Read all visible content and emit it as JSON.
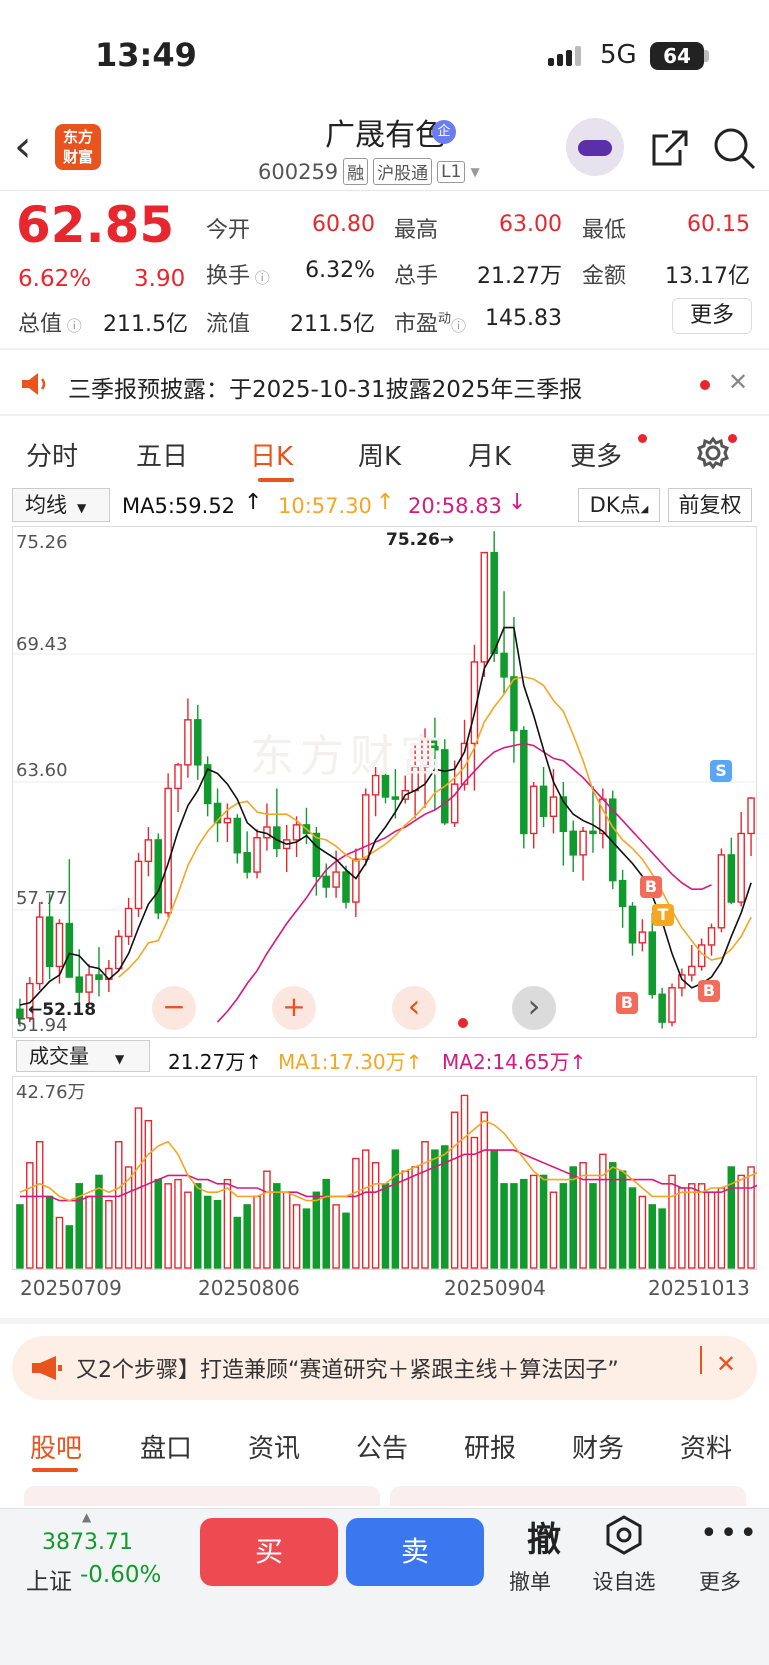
{
  "status_bar": {
    "time": "13:49",
    "network": "5G",
    "battery": "64"
  },
  "header": {
    "logo_line1": "东方",
    "logo_line2": "财富",
    "name": "广晟有色",
    "name_badge": "企",
    "code": "600259",
    "tags": [
      "融",
      "沪股通",
      "L1"
    ]
  },
  "quote": {
    "price": "62.85",
    "change_pct": "6.62%",
    "change_amt": "3.90",
    "rows": [
      [
        {
          "label": "今开",
          "value": "60.80",
          "color": "red"
        },
        {
          "label": "最高",
          "value": "63.00",
          "color": "red"
        },
        {
          "label": "最低",
          "value": "60.15",
          "color": "red"
        }
      ],
      [
        {
          "label": "换手",
          "value": "6.32%",
          "color": "dark"
        },
        {
          "label": "总手",
          "value": "21.27万",
          "color": "dark"
        },
        {
          "label": "金额",
          "value": "13.17亿",
          "color": "dark"
        }
      ],
      [
        {
          "label": "总值",
          "value": "211.5亿",
          "color": "dark"
        },
        {
          "label": "流值",
          "value": "211.5亿",
          "color": "dark"
        },
        {
          "label": "市盈",
          "sup": "动",
          "value": "145.83",
          "color": "dark"
        }
      ]
    ],
    "more_label": "更多"
  },
  "notice": {
    "text": "三季报预披露：于2025-10-31披露2025年三季报"
  },
  "period_tabs": [
    "分时",
    "五日",
    "日K",
    "周K",
    "月K",
    "更多"
  ],
  "active_period": "日K",
  "chart_toolbar": {
    "indicator": "均线",
    "ma5": "MA5:59.52",
    "ma10": "10:57.30",
    "ma20": "20:58.83",
    "dk": "DK点",
    "adjust": "前复权"
  },
  "volume_toolbar": {
    "indicator": "成交量",
    "value": "21.27万",
    "ma1": "MA1:17.30万",
    "ma2": "MA2:14.65万"
  },
  "colors": {
    "up": "#e8262e",
    "down": "#119a2d",
    "ma5": "#111111",
    "ma10": "#f5a623",
    "ma20": "#d6197e",
    "accent": "#e8531e"
  },
  "chart_data": {
    "type": "candlestick",
    "price_axis": {
      "ticks": [
        "75.26",
        "69.43",
        "63.60",
        "57.77",
        "51.94"
      ],
      "ylim": [
        51.94,
        75.26
      ]
    },
    "volume_axis": {
      "max_label": "42.76万",
      "ylim": [
        0,
        42.76
      ]
    },
    "x_labels": [
      "20250709",
      "20250806",
      "20250904",
      "20251013"
    ],
    "annotations": {
      "high": "75.26→",
      "low": "←52.18",
      "signals": [
        "B",
        "T",
        "B",
        "B",
        "S"
      ]
    },
    "candles": [
      [
        53.0,
        53.5,
        52.2,
        52.6
      ],
      [
        52.6,
        54.5,
        52.4,
        54.2
      ],
      [
        54.2,
        58.0,
        53.9,
        57.3
      ],
      [
        57.3,
        58.4,
        54.4,
        55.0
      ],
      [
        55.0,
        57.2,
        54.2,
        57.0
      ],
      [
        57.0,
        60.0,
        54.6,
        54.5
      ],
      [
        54.5,
        55.8,
        53.1,
        53.8
      ],
      [
        53.8,
        55.1,
        53.3,
        54.6
      ],
      [
        54.6,
        55.9,
        53.6,
        54.4
      ],
      [
        54.4,
        55.3,
        53.8,
        54.9
      ],
      [
        54.9,
        56.7,
        54.8,
        56.4
      ],
      [
        56.4,
        58.2,
        56.0,
        57.7
      ],
      [
        57.7,
        60.3,
        57.3,
        59.9
      ],
      [
        59.9,
        61.5,
        59.2,
        60.9
      ],
      [
        60.9,
        61.2,
        57.2,
        57.5
      ],
      [
        57.5,
        64.0,
        57.3,
        63.3
      ],
      [
        63.3,
        64.5,
        62.2,
        64.4
      ],
      [
        64.4,
        67.5,
        63.8,
        66.5
      ],
      [
        66.5,
        67.2,
        63.7,
        64.4
      ],
      [
        64.4,
        64.8,
        62.0,
        62.6
      ],
      [
        62.6,
        63.3,
        60.8,
        61.7
      ],
      [
        61.7,
        62.6,
        60.8,
        61.9
      ],
      [
        61.9,
        62.1,
        59.8,
        60.3
      ],
      [
        60.3,
        61.3,
        59.1,
        59.4
      ],
      [
        59.4,
        61.4,
        59.1,
        61.0
      ],
      [
        61.0,
        62.6,
        60.4,
        61.5
      ],
      [
        61.5,
        63.3,
        60.1,
        60.5
      ],
      [
        60.5,
        61.6,
        59.4,
        60.9
      ],
      [
        60.9,
        62.0,
        60.1,
        61.6
      ],
      [
        61.6,
        62.4,
        60.7,
        61.2
      ],
      [
        61.2,
        61.5,
        58.3,
        59.2
      ],
      [
        59.2,
        59.8,
        58.2,
        58.7
      ],
      [
        58.7,
        60.4,
        58.2,
        59.4
      ],
      [
        59.4,
        59.7,
        57.7,
        58.0
      ],
      [
        58.0,
        60.5,
        57.3,
        60.0
      ],
      [
        60.0,
        63.3,
        59.7,
        63.0
      ],
      [
        63.0,
        64.3,
        62.0,
        63.9
      ],
      [
        63.9,
        64.7,
        62.6,
        62.9
      ],
      [
        62.9,
        64.2,
        61.9,
        62.8
      ],
      [
        62.8,
        63.9,
        62.6,
        63.2
      ],
      [
        63.2,
        65.3,
        61.9,
        64.3
      ],
      [
        64.3,
        66.1,
        62.4,
        65.6
      ],
      [
        65.6,
        66.6,
        62.3,
        65.1
      ],
      [
        65.1,
        65.6,
        61.6,
        61.7
      ],
      [
        61.7,
        64.6,
        61.5,
        63.5
      ],
      [
        63.5,
        66.5,
        63.2,
        65.4
      ],
      [
        65.4,
        70.0,
        63.2,
        69.2
      ],
      [
        69.2,
        74.3,
        68.5,
        74.3
      ],
      [
        74.3,
        75.3,
        69.2,
        69.6
      ],
      [
        69.6,
        72.5,
        67.7,
        68.5
      ],
      [
        68.5,
        71.3,
        64.5,
        66.0
      ],
      [
        66.0,
        66.2,
        60.5,
        61.2
      ],
      [
        61.2,
        63.6,
        60.5,
        63.4
      ],
      [
        63.4,
        64.3,
        61.5,
        62.0
      ],
      [
        62.0,
        64.2,
        61.2,
        62.9
      ],
      [
        62.9,
        63.6,
        59.7,
        61.3
      ],
      [
        61.3,
        61.8,
        59.4,
        60.2
      ],
      [
        60.2,
        61.5,
        59.0,
        61.3
      ],
      [
        61.3,
        63.4,
        60.3,
        61.2
      ],
      [
        61.2,
        63.3,
        60.5,
        62.8
      ],
      [
        62.8,
        63.2,
        58.6,
        59.0
      ],
      [
        59.0,
        59.5,
        56.8,
        57.8
      ],
      [
        57.8,
        58.0,
        55.5,
        56.1
      ],
      [
        56.1,
        57.2,
        55.7,
        56.6
      ],
      [
        56.6,
        57.5,
        53.5,
        53.7
      ],
      [
        53.7,
        54.0,
        52.1,
        52.4
      ],
      [
        52.4,
        54.2,
        52.2,
        54.0
      ],
      [
        54.0,
        54.9,
        53.6,
        54.6
      ],
      [
        54.6,
        56.0,
        54.3,
        55.0
      ],
      [
        55.0,
        56.3,
        54.8,
        56.0
      ],
      [
        56.0,
        57.0,
        55.5,
        56.8
      ],
      [
        56.8,
        60.5,
        56.6,
        60.2
      ],
      [
        60.2,
        61.0,
        57.9,
        58.0
      ],
      [
        58.0,
        62.2,
        57.8,
        61.2
      ],
      [
        61.2,
        62.9,
        60.15,
        62.85
      ]
    ],
    "ma5": [
      53.2,
      53.3,
      53.8,
      54.3,
      54.6,
      55.6,
      55.5,
      55.0,
      54.9,
      54.4,
      54.8,
      55.6,
      56.8,
      57.9,
      58.5,
      59.8,
      61.3,
      62.5,
      63.2,
      64.2,
      64.0,
      63.5,
      62.8,
      61.7,
      61.3,
      61.2,
      60.9,
      60.7,
      60.8,
      61.1,
      60.6,
      60.3,
      60.0,
      59.5,
      59.1,
      59.8,
      60.9,
      61.5,
      62.2,
      63.0,
      63.2,
      63.5,
      64.2,
      64.1,
      64.2,
      65.0,
      66.8,
      68.9,
      69.7,
      70.8,
      70.8,
      68.1,
      66.7,
      65.1,
      63.6,
      62.7,
      62.1,
      61.8,
      61.6,
      61.3,
      60.8,
      60.3,
      59.8,
      59.2,
      58.3,
      57.1,
      55.6,
      54.4,
      54.0,
      54.2,
      54.5,
      55.2,
      56.4,
      57.5,
      58.9
    ],
    "ma10": [
      null,
      null,
      null,
      null,
      null,
      null,
      null,
      null,
      null,
      null,
      54.5,
      54.9,
      55.4,
      56.1,
      56.2,
      57.2,
      58.4,
      59.7,
      60.6,
      61.3,
      61.8,
      62.3,
      62.6,
      62.7,
      62.2,
      62.1,
      62.1,
      62.1,
      61.8,
      61.4,
      61.0,
      60.9,
      60.6,
      60.2,
      59.9,
      60.1,
      60.4,
      60.7,
      61.1,
      61.6,
      62.0,
      62.5,
      63.1,
      63.4,
      63.8,
      64.3,
      65.2,
      66.4,
      67.1,
      67.7,
      68.4,
      68.5,
      68.4,
      68.1,
      67.4,
      66.9,
      65.8,
      64.6,
      63.2,
      62.3,
      61.5,
      60.9,
      60.5,
      60.0,
      59.3,
      58.5,
      57.6,
      56.8,
      56.2,
      55.6,
      55.3,
      55.4,
      55.8,
      56.4,
      57.3
    ],
    "ma20": [
      null,
      null,
      null,
      null,
      null,
      null,
      null,
      null,
      null,
      null,
      null,
      null,
      null,
      null,
      null,
      null,
      null,
      null,
      null,
      null,
      52.4,
      52.9,
      53.5,
      54.2,
      54.8,
      55.6,
      56.3,
      57.0,
      57.6,
      58.2,
      58.9,
      59.5,
      59.9,
      60.2,
      60.4,
      60.6,
      60.8,
      61.0,
      61.3,
      61.5,
      61.8,
      62.1,
      62.3,
      62.6,
      63.0,
      63.6,
      64.1,
      64.6,
      65.0,
      65.2,
      65.3,
      65.4,
      65.3,
      65.0,
      64.7,
      64.6,
      64.2,
      63.8,
      63.3,
      62.8,
      62.3,
      61.8,
      61.3,
      60.8,
      60.3,
      59.8,
      59.3,
      58.9,
      58.6,
      58.6,
      58.8
    ],
    "volume": [
      15,
      25,
      30,
      17,
      12,
      10,
      20,
      17,
      22,
      16,
      30,
      24,
      38,
      35,
      21,
      20,
      21,
      18,
      20,
      17,
      16,
      21,
      12,
      15,
      17,
      23,
      20,
      18,
      15,
      14,
      18,
      21,
      15,
      13,
      26,
      28,
      25,
      20,
      28,
      23,
      24,
      30,
      28,
      29,
      37,
      41,
      31,
      37,
      28,
      20,
      20,
      21,
      22,
      22,
      18,
      20,
      24,
      25,
      20,
      27,
      25,
      23,
      19,
      17,
      15,
      14,
      22,
      19,
      20,
      20,
      18,
      19,
      24,
      22,
      24,
      26
    ],
    "vma1": [
      18,
      19,
      20,
      19,
      17,
      16,
      17,
      18,
      19,
      18,
      19,
      21,
      24,
      27,
      29,
      30,
      27,
      22,
      19,
      18,
      18,
      19,
      17,
      17,
      17,
      18,
      18,
      18,
      17,
      16,
      16,
      17,
      17,
      17,
      18,
      19,
      20,
      20,
      22,
      23,
      24,
      25,
      26,
      27,
      29,
      31,
      33,
      35,
      34,
      32,
      29,
      26,
      23,
      21,
      21,
      21,
      21,
      22,
      22,
      22,
      24,
      23,
      21,
      19,
      17,
      17,
      17,
      18,
      18,
      18,
      19,
      19,
      20,
      21,
      22,
      23
    ],
    "vma2": [
      17,
      17,
      17,
      17,
      16,
      16,
      16,
      17,
      17,
      17,
      17,
      18,
      19,
      20,
      21,
      22,
      22,
      22,
      21,
      21,
      20,
      20,
      19,
      19,
      19,
      18,
      18,
      18,
      18,
      17,
      17,
      17,
      17,
      17,
      17,
      18,
      18,
      19,
      20,
      21,
      22,
      23,
      24,
      25,
      26,
      27,
      27,
      28,
      28,
      28,
      28,
      27,
      26,
      25,
      24,
      23,
      22,
      21,
      21,
      21,
      21,
      21,
      21,
      21,
      21,
      20,
      20,
      19,
      19,
      18,
      18,
      18,
      19,
      19,
      19,
      20
    ]
  },
  "chart_controls": {
    "zoom_out": "−",
    "zoom_in": "+",
    "prev": "‹",
    "next": "›"
  },
  "ad": {
    "text": "又2个步骤】打造兼顾“赛道研究＋紧跟主线＋算法因子”"
  },
  "bottom_tabs": [
    "股吧",
    "盘口",
    "资讯",
    "公告",
    "研报",
    "财务",
    "资料"
  ],
  "active_bottom_tab": "股吧",
  "bottom_bar": {
    "index_value": "3873.71",
    "index_name": "上证",
    "index_change": "-0.60%",
    "buy": "买",
    "sell": "卖",
    "cancel_glyph": "撤",
    "cancel": "撤单",
    "watch": "设自选",
    "more": "更多"
  }
}
